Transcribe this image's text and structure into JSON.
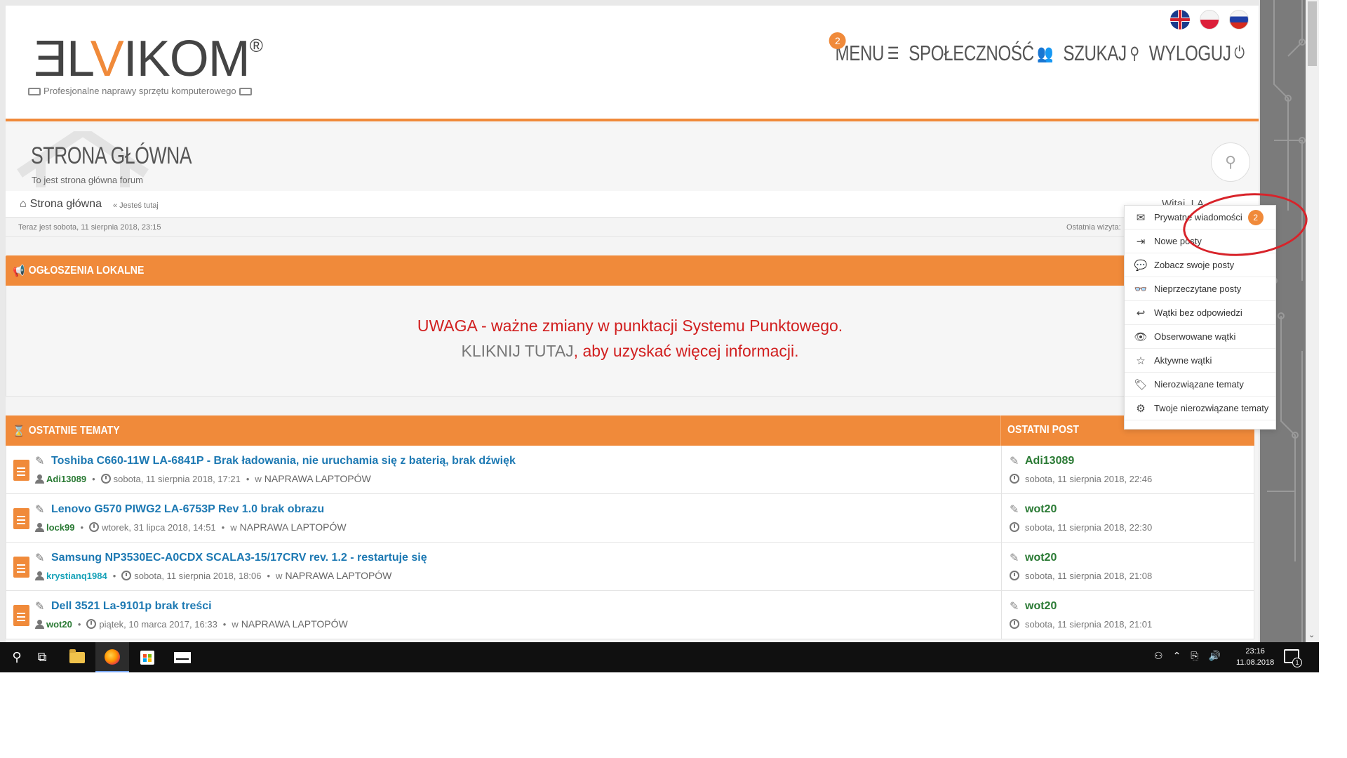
{
  "header": {
    "logo_prefix": "ƎL",
    "logo_accent": "V",
    "logo_suffix": "IKOM",
    "logo_reg": "®",
    "tagline": "Profesjonalne naprawy sprzętu komputerowego",
    "nav": {
      "menu_label": "MENU",
      "menu_badge": "2",
      "community_label": "SPOŁECZNOŚĆ",
      "search_label": "SZUKAJ",
      "logout_label": "WYLOGUJ"
    },
    "flags": [
      "uk-flag-icon",
      "poland-flag-icon",
      "russia-flag-icon"
    ]
  },
  "titleband": {
    "title": "STRONA GŁÓWNA",
    "subtitle": "To jest strona główna forum"
  },
  "breadcrumb": {
    "home": "Strona główna",
    "here": "« Jesteś tutaj",
    "welcome": "Witaj, LA..."
  },
  "infobar": {
    "now": "Teraz jest sobota, 11 sierpnia 2018, 23:15",
    "last_visit": "Ostatnia wizyta:"
  },
  "announcement": {
    "header": "OGŁOSZENIA LOKALNE",
    "line1": "UWAGA - ważne zmiany w punktacji Systemu Punktowego.",
    "link": "KLIKNIJ TUTAJ",
    "line2_rest": ", aby uzyskać więcej informacji."
  },
  "topics": {
    "header": "OSTATNIE TEMATY",
    "lastpost_header": "OSTATNI POST",
    "rows": [
      {
        "title": "Toshiba C660-11W LA-6841P - Brak ładowania, nie uruchamia się z baterią, brak dźwięk",
        "user": "Adi13089",
        "date": "sobota, 11 sierpnia 2018, 17:21",
        "in": "w",
        "forum": "NAPRAWA LAPTOPÓW",
        "lp_user": "Adi13089",
        "lp_date": "sobota, 11 sierpnia 2018, 22:46"
      },
      {
        "title": "Lenovo G570 PIWG2 LA-6753P Rev 1.0 brak obrazu",
        "user": "lock99",
        "date": "wtorek, 31 lipca 2018, 14:51",
        "in": "w",
        "forum": "NAPRAWA LAPTOPÓW",
        "lp_user": "wot20",
        "lp_date": "sobota, 11 sierpnia 2018, 22:30"
      },
      {
        "title": "Samsung NP3530EC-A0CDX SCALA3-15/17CRV rev. 1.2 - restartuje się",
        "user": "krystianq1984",
        "date": "sobota, 11 sierpnia 2018, 18:06",
        "in": "w",
        "forum": "NAPRAWA LAPTOPÓW",
        "lp_user": "wot20",
        "lp_date": "sobota, 11 sierpnia 2018, 21:08"
      },
      {
        "title": "Dell 3521 La-9101p brak treści",
        "user": "wot20",
        "date": "piątek, 10 marca 2017, 16:33",
        "in": "w",
        "forum": "NAPRAWA LAPTOPÓW",
        "lp_user": "wot20",
        "lp_date": "sobota, 11 sierpnia 2018, 21:01"
      }
    ]
  },
  "dropdown": {
    "items": [
      {
        "label": "Prywatne wiadomości",
        "icon": "envelope-icon",
        "badge": "2"
      },
      {
        "label": "Nowe posty",
        "icon": "signin-icon"
      },
      {
        "label": "Zobacz swoje posty",
        "icon": "comments-icon"
      },
      {
        "label": "Nieprzeczytane posty",
        "icon": "glasses-icon"
      },
      {
        "label": "Wątki bez odpowiedzi",
        "icon": "reply-icon"
      },
      {
        "label": "Obserwowane wątki",
        "icon": "eye-icon"
      },
      {
        "label": "Aktywne wątki",
        "icon": "star-icon"
      },
      {
        "label": "Nierozwiązane tematy",
        "icon": "tag-icon"
      },
      {
        "label": "Twoje nierozwiązane tematy",
        "icon": "user-gear-icon"
      }
    ]
  },
  "taskbar": {
    "time": "23:16",
    "date": "11.08.2018",
    "notify_count": "1"
  },
  "colors": {
    "accent": "#f08a3a",
    "link": "#1d79b3",
    "user_green": "#2a7a34",
    "alert_red": "#d11f1f",
    "annotation_circle": "#d8232a"
  }
}
